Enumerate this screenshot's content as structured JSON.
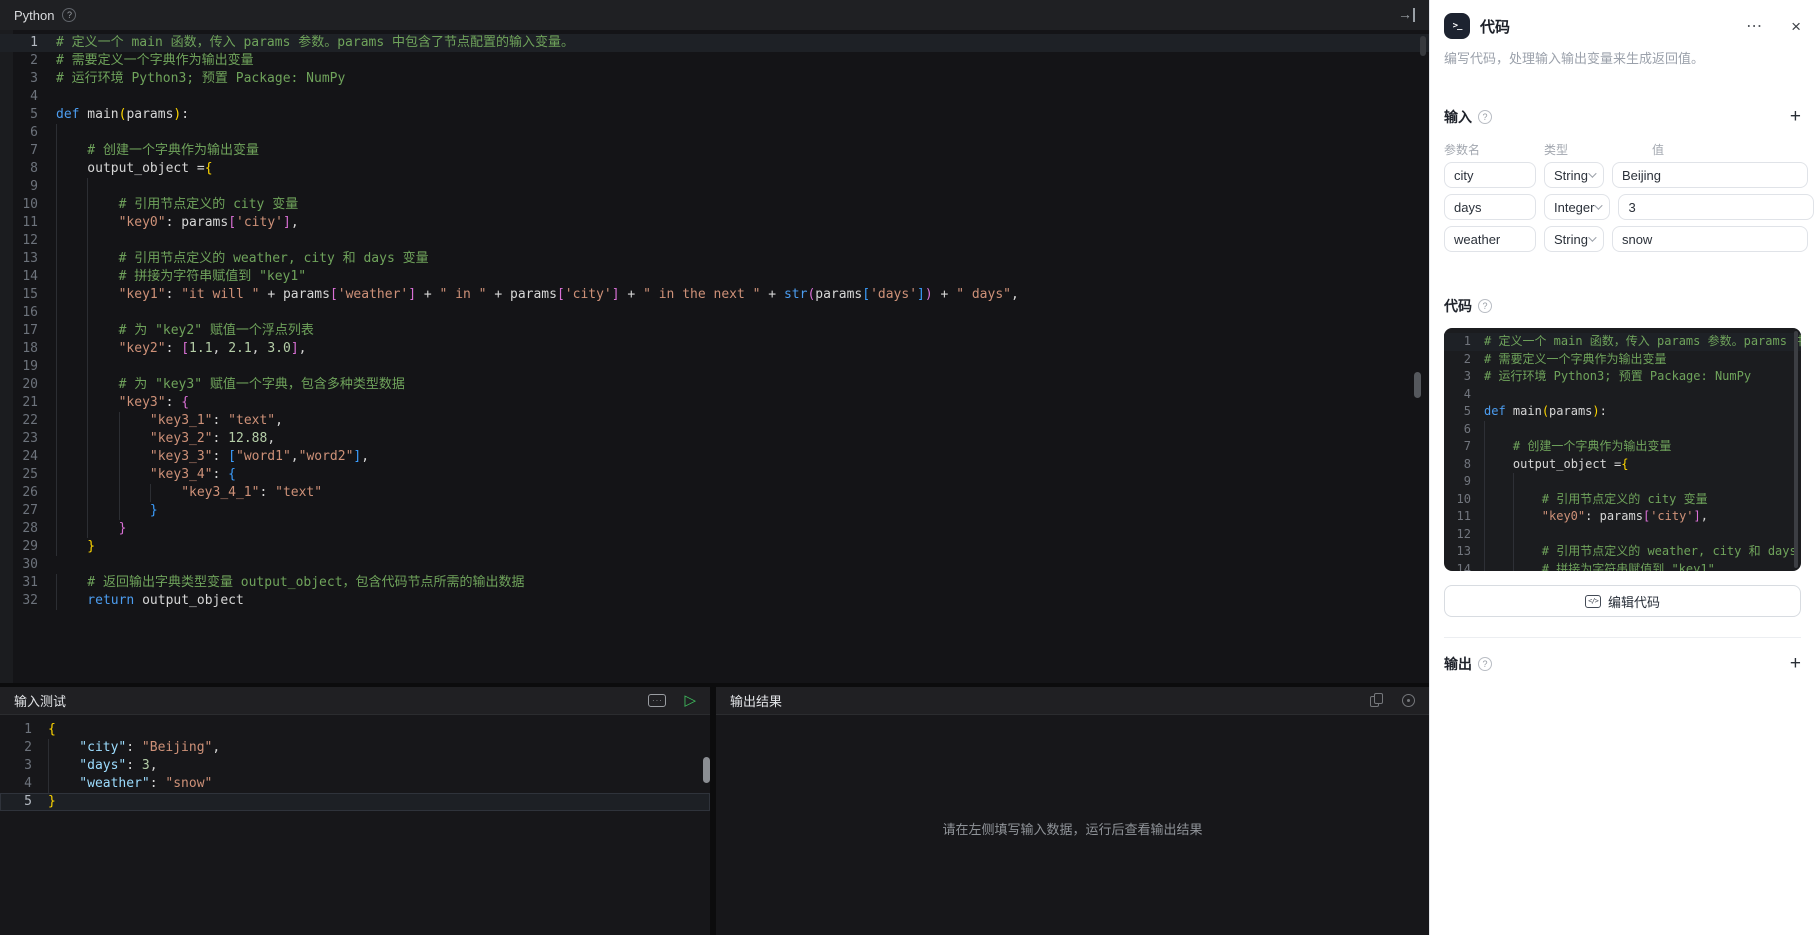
{
  "editor": {
    "title": "Python",
    "lines": [
      {
        "n": 1,
        "g": 0,
        "active": true,
        "s": [
          [
            "# 定义一个 main 函数，传入 params 参数。params 中包含了节点配置的输入变量。",
            "cm"
          ]
        ]
      },
      {
        "n": 2,
        "g": 0,
        "s": [
          [
            "# 需要定义一个字典作为输出变量",
            "cm"
          ]
        ]
      },
      {
        "n": 3,
        "g": 0,
        "s": [
          [
            "# 运行环境 Python3; 预置 Package: NumPy",
            "cm"
          ]
        ]
      },
      {
        "n": 4,
        "g": 0,
        "s": []
      },
      {
        "n": 5,
        "g": 0,
        "s": [
          [
            "def",
            "kw"
          ],
          [
            " main",
            "tx"
          ],
          [
            "(",
            "b1"
          ],
          [
            "params",
            "tx"
          ],
          [
            ")",
            "b1"
          ],
          [
            ":",
            "tx"
          ]
        ]
      },
      {
        "n": 6,
        "g": 1,
        "s": []
      },
      {
        "n": 7,
        "g": 1,
        "s": [
          [
            "# 创建一个字典作为输出变量",
            "cm"
          ]
        ]
      },
      {
        "n": 8,
        "g": 1,
        "s": [
          [
            "output_object =",
            "tx"
          ],
          [
            "{",
            "b1"
          ]
        ]
      },
      {
        "n": 9,
        "g": 2,
        "s": []
      },
      {
        "n": 10,
        "g": 2,
        "s": [
          [
            "# 引用节点定义的 city 变量",
            "cm"
          ]
        ]
      },
      {
        "n": 11,
        "g": 2,
        "s": [
          [
            "\"key0\"",
            "st"
          ],
          [
            ": ",
            "tx"
          ],
          [
            "params",
            "tx"
          ],
          [
            "[",
            "b2"
          ],
          [
            "'city'",
            "st"
          ],
          [
            "]",
            "b2"
          ],
          [
            ",",
            "tx"
          ]
        ]
      },
      {
        "n": 12,
        "g": 2,
        "s": []
      },
      {
        "n": 13,
        "g": 2,
        "s": [
          [
            "# 引用节点定义的 weather, city 和 days 变量",
            "cm"
          ]
        ]
      },
      {
        "n": 14,
        "g": 2,
        "s": [
          [
            "# 拼接为字符串赋值到 \"key1\"",
            "cm"
          ]
        ]
      },
      {
        "n": 15,
        "g": 2,
        "s": [
          [
            "\"key1\"",
            "st"
          ],
          [
            ": ",
            "tx"
          ],
          [
            "\"it will \"",
            "st"
          ],
          [
            " + ",
            "tx"
          ],
          [
            "params",
            "tx"
          ],
          [
            "[",
            "b2"
          ],
          [
            "'weather'",
            "st"
          ],
          [
            "]",
            "b2"
          ],
          [
            " + ",
            "tx"
          ],
          [
            "\" in \"",
            "st"
          ],
          [
            " + ",
            "tx"
          ],
          [
            "params",
            "tx"
          ],
          [
            "[",
            "b2"
          ],
          [
            "'city'",
            "st"
          ],
          [
            "]",
            "b2"
          ],
          [
            " + ",
            "tx"
          ],
          [
            "\" in the next \"",
            "st"
          ],
          [
            " + ",
            "tx"
          ],
          [
            "str",
            "kw"
          ],
          [
            "(",
            "b2"
          ],
          [
            "params",
            "tx"
          ],
          [
            "[",
            "b3"
          ],
          [
            "'days'",
            "st"
          ],
          [
            "]",
            "b3"
          ],
          [
            ")",
            "b2"
          ],
          [
            " + ",
            "tx"
          ],
          [
            "\" days\"",
            "st"
          ],
          [
            ",",
            "tx"
          ]
        ]
      },
      {
        "n": 16,
        "g": 2,
        "s": []
      },
      {
        "n": 17,
        "g": 2,
        "s": [
          [
            "# 为 \"key2\" 赋值一个浮点列表",
            "cm"
          ]
        ]
      },
      {
        "n": 18,
        "g": 2,
        "s": [
          [
            "\"key2\"",
            "st"
          ],
          [
            ": ",
            "tx"
          ],
          [
            "[",
            "b2"
          ],
          [
            "1.1",
            "nu"
          ],
          [
            ", ",
            "tx"
          ],
          [
            "2.1",
            "nu"
          ],
          [
            ", ",
            "tx"
          ],
          [
            "3.0",
            "nu"
          ],
          [
            "]",
            "b2"
          ],
          [
            ",",
            "tx"
          ]
        ]
      },
      {
        "n": 19,
        "g": 2,
        "s": []
      },
      {
        "n": 20,
        "g": 2,
        "s": [
          [
            "# 为 \"key3\" 赋值一个字典，包含多种类型数据",
            "cm"
          ]
        ]
      },
      {
        "n": 21,
        "g": 2,
        "s": [
          [
            "\"key3\"",
            "st"
          ],
          [
            ": ",
            "tx"
          ],
          [
            "{",
            "b2"
          ]
        ]
      },
      {
        "n": 22,
        "g": 3,
        "s": [
          [
            "\"key3_1\"",
            "st"
          ],
          [
            ": ",
            "tx"
          ],
          [
            "\"text\"",
            "st"
          ],
          [
            ",",
            "tx"
          ]
        ]
      },
      {
        "n": 23,
        "g": 3,
        "s": [
          [
            "\"key3_2\"",
            "st"
          ],
          [
            ": ",
            "tx"
          ],
          [
            "12.88",
            "nu"
          ],
          [
            ",",
            "tx"
          ]
        ]
      },
      {
        "n": 24,
        "g": 3,
        "s": [
          [
            "\"key3_3\"",
            "st"
          ],
          [
            ": ",
            "tx"
          ],
          [
            "[",
            "b3"
          ],
          [
            "\"word1\"",
            "st"
          ],
          [
            ",",
            "tx"
          ],
          [
            "\"word2\"",
            "st"
          ],
          [
            "]",
            "b3"
          ],
          [
            ",",
            "tx"
          ]
        ]
      },
      {
        "n": 25,
        "g": 3,
        "s": [
          [
            "\"key3_4\"",
            "st"
          ],
          [
            ": ",
            "tx"
          ],
          [
            "{",
            "b3"
          ]
        ]
      },
      {
        "n": 26,
        "g": 4,
        "s": [
          [
            "\"key3_4_1\"",
            "st"
          ],
          [
            ": ",
            "tx"
          ],
          [
            "\"text\"",
            "st"
          ]
        ]
      },
      {
        "n": 27,
        "g": 3,
        "s": [
          [
            "}",
            "b3"
          ]
        ]
      },
      {
        "n": 28,
        "g": 2,
        "s": [
          [
            "}",
            "b2"
          ]
        ]
      },
      {
        "n": 29,
        "g": 1,
        "s": [
          [
            "}",
            "b1"
          ]
        ]
      },
      {
        "n": 30,
        "g": 0,
        "s": []
      },
      {
        "n": 31,
        "g": 1,
        "s": [
          [
            "# 返回输出字典类型变量 output_object，包含代码节点所需的输出数据",
            "cm"
          ]
        ]
      },
      {
        "n": 32,
        "g": 1,
        "s": [
          [
            "return",
            "kw"
          ],
          [
            " output_object",
            "tx"
          ]
        ]
      }
    ]
  },
  "input_test": {
    "title": "输入测试",
    "lines": [
      {
        "n": 1,
        "g": 0,
        "s": [
          [
            "{",
            "b1"
          ]
        ]
      },
      {
        "n": 2,
        "g": 1,
        "s": [
          [
            "\"city\"",
            "key"
          ],
          [
            ": ",
            "tx"
          ],
          [
            "\"Beijing\"",
            "st"
          ],
          [
            ",",
            "tx"
          ]
        ]
      },
      {
        "n": 3,
        "g": 1,
        "s": [
          [
            "\"days\"",
            "key"
          ],
          [
            ": ",
            "tx"
          ],
          [
            "3",
            "nu"
          ],
          [
            ",",
            "tx"
          ]
        ]
      },
      {
        "n": 4,
        "g": 1,
        "s": [
          [
            "\"weather\"",
            "key"
          ],
          [
            ": ",
            "tx"
          ],
          [
            "\"snow\"",
            "st"
          ]
        ]
      },
      {
        "n": 5,
        "g": 0,
        "active": true,
        "s": [
          [
            "}",
            "b1"
          ]
        ]
      }
    ]
  },
  "output_panel": {
    "title": "输出结果",
    "placeholder": "请在左侧填写输入数据，运行后查看输出结果"
  },
  "sidebar": {
    "title": "代码",
    "description": "编写代码，处理输入输出变量来生成返回值。",
    "inputs": {
      "title": "输入",
      "columns": [
        "参数名",
        "类型",
        "值"
      ],
      "rows": [
        {
          "name": "city",
          "type": "String",
          "value": "Beijing"
        },
        {
          "name": "days",
          "type": "Integer",
          "value": "3"
        },
        {
          "name": "weather",
          "type": "String",
          "value": "snow"
        }
      ]
    },
    "code": {
      "title": "代码",
      "edit_button": "编辑代码",
      "preview_line_count": 14
    },
    "outputs": {
      "title": "输出"
    }
  },
  "colors": {
    "run_green": "#3fbf5e",
    "bracket_level_1": "#ffd700",
    "bracket_level_2": "#da70d6",
    "bracket_level_3": "#3b9eff",
    "editor_bg": "#141417",
    "sidebar_bg": "#ffffff"
  }
}
